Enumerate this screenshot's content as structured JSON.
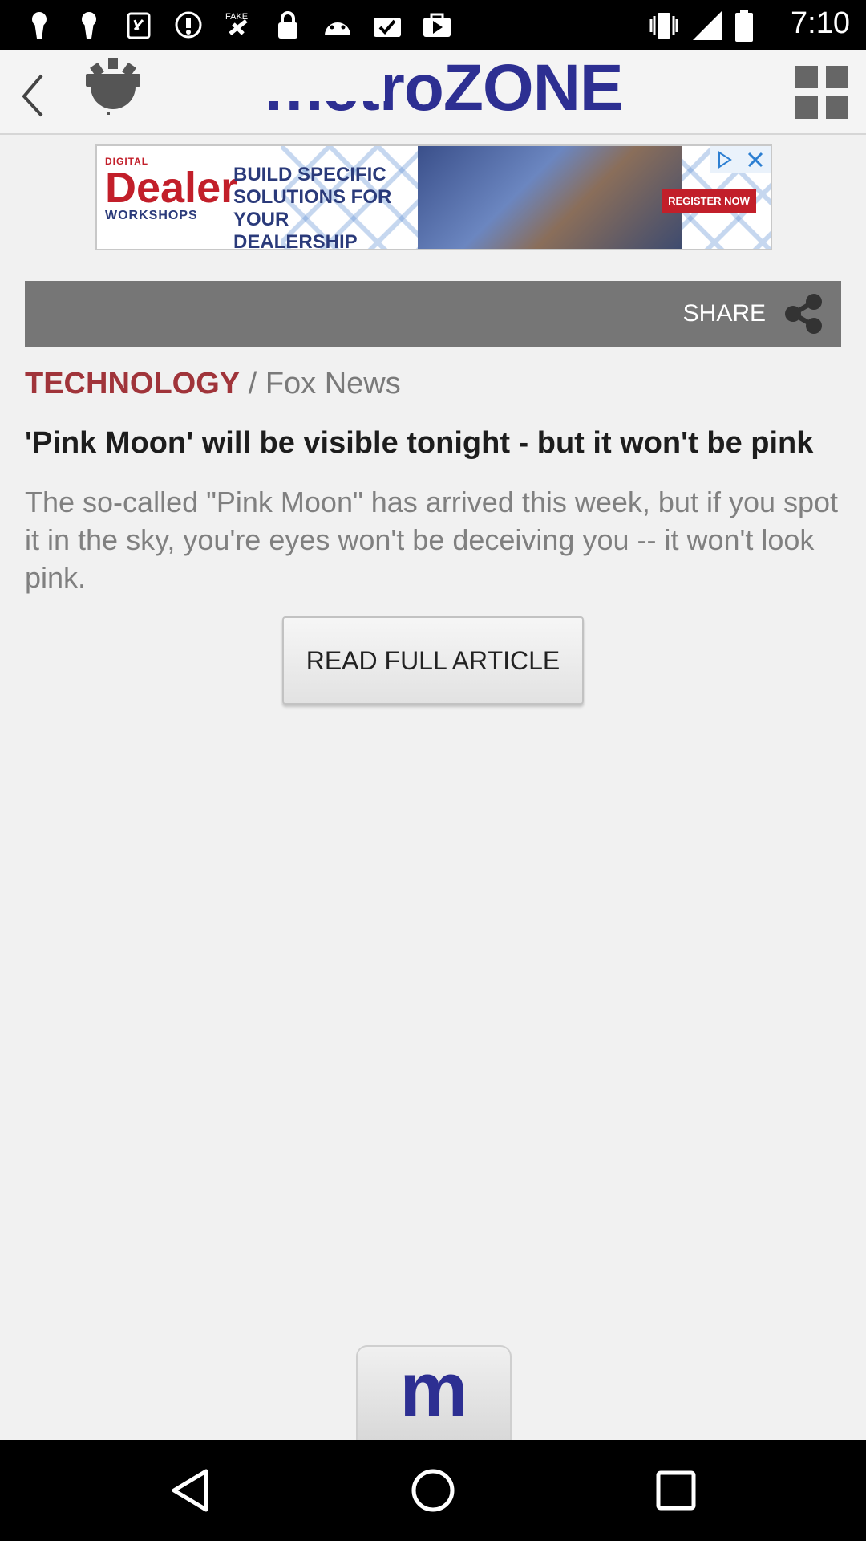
{
  "status_bar": {
    "time": "7:10"
  },
  "header": {
    "logo_prefix": "metro",
    "logo_suffix": "ZONE"
  },
  "ad": {
    "brand_small": "DIGITAL",
    "brand": "Dealer",
    "brand_sub": "WORKSHOPS",
    "text": "BUILD SPECIFIC SOLUTIONS FOR YOUR DEALERSHIP",
    "cta": "REGISTER NOW"
  },
  "share": {
    "label": "SHARE"
  },
  "article": {
    "category": "TECHNOLOGY",
    "separator": "/",
    "source": "Fox News",
    "headline": "'Pink Moon' will be visible tonight - but it won't be pink",
    "summary": "The so-called \"Pink Moon\" has arrived this week, but if you spot it in the sky, you're eyes won't be deceiving you -- it won't look pink.",
    "read_button": "READ FULL ARTICLE"
  },
  "bottom_tab": {
    "label": "m"
  },
  "colors": {
    "brand_blue": "#2d2f92",
    "category_red": "#a0343a",
    "share_bar": "#767676"
  }
}
